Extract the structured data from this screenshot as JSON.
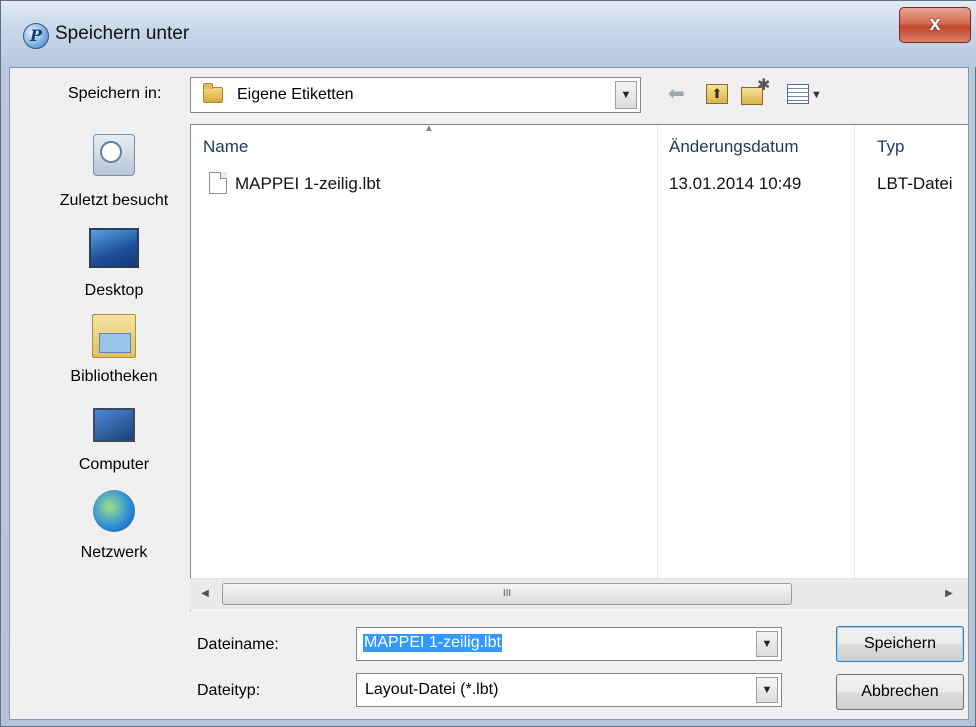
{
  "window": {
    "title": "Speichern unter",
    "close_glyph": "x",
    "app_icon_glyph": "P"
  },
  "toolbar": {
    "save_in_label": "Speichern in:",
    "save_in_value": "Eigene Etiketten",
    "icons": [
      "back-arrow-icon",
      "up-folder-icon",
      "new-folder-icon",
      "view-menu-icon"
    ]
  },
  "places": [
    {
      "label": "Zuletzt besucht",
      "icon": "recent-places-icon"
    },
    {
      "label": "Desktop",
      "icon": "desktop-icon"
    },
    {
      "label": "Bibliotheken",
      "icon": "libraries-icon"
    },
    {
      "label": "Computer",
      "icon": "computer-icon"
    },
    {
      "label": "Netzwerk",
      "icon": "network-icon"
    }
  ],
  "file_list": {
    "columns": [
      "Name",
      "Änderungsdatum",
      "Typ"
    ],
    "rows": [
      {
        "name": "MAPPEI 1-zeilig.lbt",
        "modified": "13.01.2014 10:49",
        "type": "LBT-Datei"
      }
    ],
    "scrollbar_grip": "III"
  },
  "form": {
    "filename_label": "Dateiname:",
    "filename_value": "MAPPEI 1-zeilig.lbt",
    "filetype_label": "Dateityp:",
    "filetype_value": "Layout-Datei (*.lbt)"
  },
  "buttons": {
    "save": "Speichern",
    "cancel": "Abbrechen"
  },
  "colors": {
    "selection": "#3399ff",
    "close_button": "#c2452a"
  }
}
